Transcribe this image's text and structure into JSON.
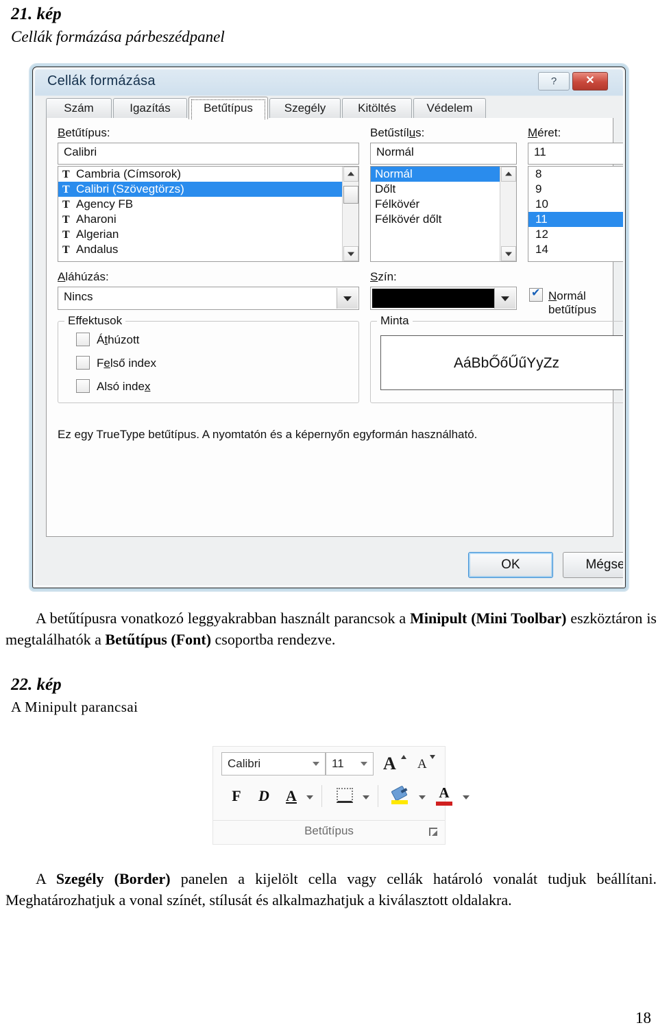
{
  "figure21": {
    "number": "21. kép",
    "title": "Cellák formázása párbeszédpanel"
  },
  "dialog": {
    "title": "Cellák formázása",
    "help_label": "?",
    "close_label": "✕",
    "tabs": [
      {
        "label": "Szám",
        "selected": false
      },
      {
        "label": "Igazítás",
        "selected": false
      },
      {
        "label": "Betűtípus",
        "selected": true
      },
      {
        "label": "Szegély",
        "selected": false
      },
      {
        "label": "Kitöltés",
        "selected": false
      },
      {
        "label": "Védelem",
        "selected": false
      }
    ],
    "font": {
      "label": "Betűtípus:",
      "value": "Calibri",
      "items": [
        "Cambria (Címsorok)",
        "Calibri (Szövegtörzs)",
        "Agency FB",
        "Aharoni",
        "Algerian",
        "Andalus"
      ],
      "selected_index": 1,
      "item_icon": "truetype-icon"
    },
    "style": {
      "label": "Betűstílus:",
      "value": "Normál",
      "items": [
        "Normál",
        "Dőlt",
        "Félkövér",
        "Félkövér dőlt"
      ],
      "selected_index": 0
    },
    "size": {
      "label": "Méret:",
      "value": "11",
      "items": [
        "8",
        "9",
        "10",
        "11",
        "12",
        "14"
      ],
      "selected_index": 3
    },
    "underline": {
      "label": "Aláhúzás:",
      "value": "Nincs"
    },
    "color": {
      "label": "Szín:",
      "value": "#000000"
    },
    "normal_font_checkbox": {
      "label": "Normál betűtípus",
      "checked": true
    },
    "effects": {
      "label": "Effektusok",
      "items": [
        {
          "label": "Áthúzott",
          "checked": false
        },
        {
          "label": "Felső index",
          "checked": false
        },
        {
          "label": "Alsó index",
          "checked": false
        }
      ]
    },
    "preview": {
      "label": "Minta",
      "sample_text": "AáBbŐőŰűYyZz"
    },
    "truetype_note": "Ez egy TrueType betűtípus.  A nyomtatón és a képernyőn egyformán használható.",
    "ok_label": "OK",
    "cancel_label": "Mégse"
  },
  "paragraph1": {
    "part1": "A betűtípusra vonatkozó leggyakrabban használt parancsok a ",
    "bold1": "Minipult (Mini Toolbar)",
    "part2": " eszköztáron is megtalálhatók a ",
    "bold2": "Betűtípus (Font)",
    "part3": " csoportba rendezve."
  },
  "figure22": {
    "number": "22. kép",
    "title": "A Minipult parancsai"
  },
  "minitoolbar": {
    "font_name": "Calibri",
    "font_size": "11",
    "grow_font": "A",
    "shrink_font": "A",
    "bold": "F",
    "italic": "D",
    "underline": "A",
    "borders_icon": "borders-icon",
    "fill_icon": "fill-color-icon",
    "font_color": "A",
    "group_label": "Betűtípus",
    "launcher_icon": "dialog-launcher-icon",
    "accents": {
      "highlight_yellow": "#ffe800",
      "font_red": "#d01f1f"
    }
  },
  "paragraph2": {
    "part1": "A ",
    "bold1": "Szegély (Border)",
    "part2": " panelen a kijelölt cella vagy cellák határoló vonalát tudjuk beállítani. Meghatározhatjuk a vonal színét, stílusát és alkalmazhatjuk a kiválasztott oldalakra."
  },
  "page_number": "18"
}
